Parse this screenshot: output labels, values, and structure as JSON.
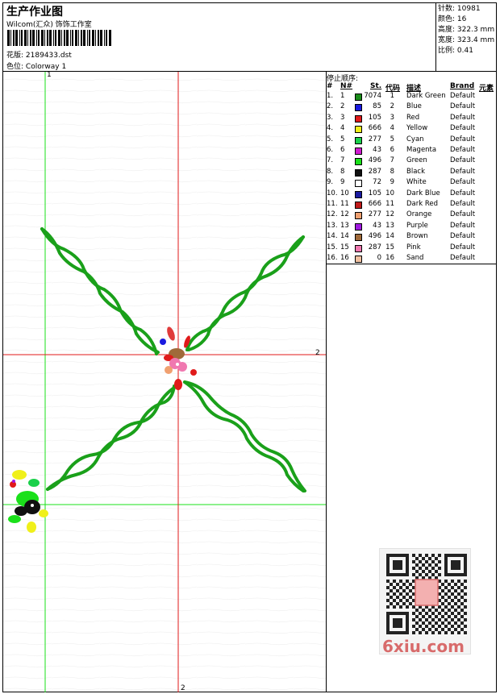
{
  "header": {
    "title": "生产作业图",
    "company": "Wilcom(汇众) 饰饰工作室",
    "design_label": "花版:",
    "design_file": "2189433.dst",
    "colorway_label": "色位:",
    "colorway": "Colorway 1"
  },
  "stats": {
    "stitches_label": "针数:",
    "stitches": "10981",
    "colors_label": "颜色:",
    "colors": "16",
    "height_label": "高度:",
    "height": "322.3 mm",
    "width_label": "宽度:",
    "width": "323.4 mm",
    "scale_label": "比例:",
    "scale": "0.41"
  },
  "table": {
    "title": "停止顺序:",
    "headers": {
      "order": "#",
      "no": "N#",
      "st": "St.",
      "code": "代码",
      "desc": "描述",
      "brand": "Brand",
      "element": "元素"
    },
    "rows": [
      {
        "order": "1.",
        "no": "1",
        "color": "#1a8c1a",
        "st": "7074",
        "code": "1",
        "desc": "Dark Green",
        "brand": "Default"
      },
      {
        "order": "2.",
        "no": "2",
        "color": "#1a1ae0",
        "st": "85",
        "code": "2",
        "desc": "Blue",
        "brand": "Default"
      },
      {
        "order": "3.",
        "no": "3",
        "color": "#e01a1a",
        "st": "105",
        "code": "3",
        "desc": "Red",
        "brand": "Default"
      },
      {
        "order": "4.",
        "no": "4",
        "color": "#f0f01a",
        "st": "666",
        "code": "4",
        "desc": "Yellow",
        "brand": "Default"
      },
      {
        "order": "5.",
        "no": "5",
        "color": "#1ad04a",
        "st": "277",
        "code": "5",
        "desc": "Cyan",
        "brand": "Default"
      },
      {
        "order": "6.",
        "no": "6",
        "color": "#d01ad0",
        "st": "43",
        "code": "6",
        "desc": "Magenta",
        "brand": "Default"
      },
      {
        "order": "7.",
        "no": "7",
        "color": "#1ae01a",
        "st": "496",
        "code": "7",
        "desc": "Green",
        "brand": "Default"
      },
      {
        "order": "8.",
        "no": "8",
        "color": "#101010",
        "st": "287",
        "code": "8",
        "desc": "Black",
        "brand": "Default"
      },
      {
        "order": "9.",
        "no": "9",
        "color": "#ffffff",
        "st": "72",
        "code": "9",
        "desc": "White",
        "brand": "Default"
      },
      {
        "order": "10.",
        "no": "10",
        "color": "#1a1aa0",
        "st": "105",
        "code": "10",
        "desc": "Dark Blue",
        "brand": "Default"
      },
      {
        "order": "11.",
        "no": "11",
        "color": "#c01a1a",
        "st": "666",
        "code": "11",
        "desc": "Dark Red",
        "brand": "Default"
      },
      {
        "order": "12.",
        "no": "12",
        "color": "#f0a070",
        "st": "277",
        "code": "12",
        "desc": "Orange",
        "brand": "Default"
      },
      {
        "order": "13.",
        "no": "13",
        "color": "#a01ae0",
        "st": "43",
        "code": "13",
        "desc": "Purple",
        "brand": "Default"
      },
      {
        "order": "14.",
        "no": "14",
        "color": "#a06a3a",
        "st": "496",
        "code": "14",
        "desc": "Brown",
        "brand": "Default"
      },
      {
        "order": "15.",
        "no": "15",
        "color": "#f078b0",
        "st": "287",
        "code": "15",
        "desc": "Pink",
        "brand": "Default"
      },
      {
        "order": "16.",
        "no": "16",
        "color": "#f0c0a0",
        "st": "0",
        "code": "16",
        "desc": "Sand",
        "brand": "Default"
      }
    ]
  },
  "canvas": {
    "guide_top_label": "1",
    "guide_right_label": "2",
    "guide_bottom_label": "2"
  },
  "watermark": {
    "text": "6xiu.com",
    "stamp_icon": "qr-code-icon"
  }
}
